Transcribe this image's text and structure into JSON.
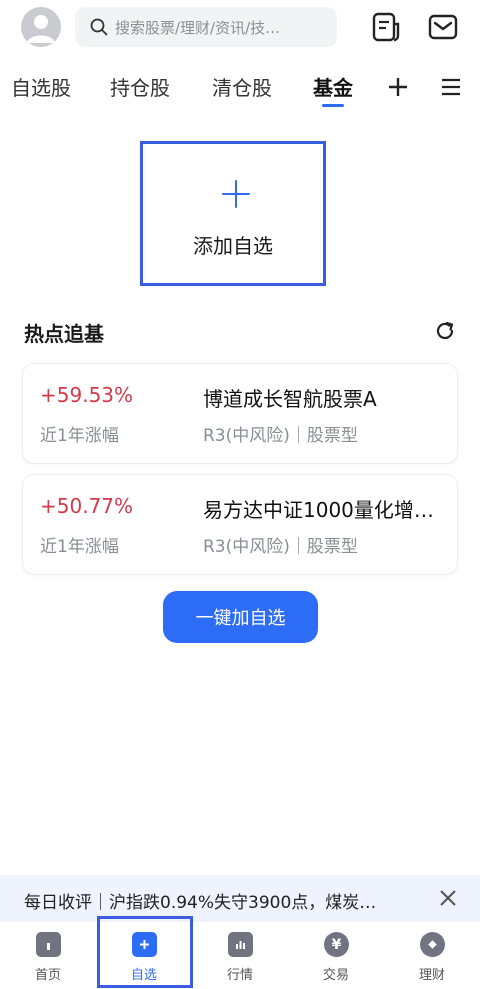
{
  "header": {
    "avatar_icon": "avatar-icon",
    "search_placeholder": "搜索股票/理财/资讯/技…",
    "icons": [
      "document-icon",
      "mail-icon"
    ]
  },
  "tabs": [
    {
      "label": "自选股"
    },
    {
      "label": "持仓股"
    },
    {
      "label": "清仓股"
    },
    {
      "label": "基金",
      "active": true
    }
  ],
  "tab_actions": [
    "add-icon",
    "menu-icon"
  ],
  "add_box": {
    "label": "添加自选"
  },
  "hot": {
    "title": "热点追基",
    "funds": [
      {
        "rate": "+59.53%",
        "rate_label": "近1年涨幅",
        "name": "博道成长智航股票A",
        "meta": "R3(中风险)｜股票型"
      },
      {
        "rate": "+50.77%",
        "rate_label": "近1年涨幅",
        "name": "易方达中证1000量化增…",
        "meta": "R3(中风险)｜股票型"
      }
    ],
    "action_label": "一键加自选"
  },
  "ticker": {
    "text": "每日收评｜沪指跌0.94%失守3900点，煤炭…"
  },
  "bottom_nav": [
    {
      "label": "首页",
      "icon": "home-icon"
    },
    {
      "label": "自选",
      "icon": "add-square-icon",
      "active": true
    },
    {
      "label": "行情",
      "icon": "chart-icon"
    },
    {
      "label": "交易",
      "icon": "yen-icon"
    },
    {
      "label": "理财",
      "icon": "diamond-icon"
    }
  ],
  "colors": {
    "accent": "#2d6df6",
    "up": "#d53a4a",
    "highlight_border": "#3a5de0"
  }
}
